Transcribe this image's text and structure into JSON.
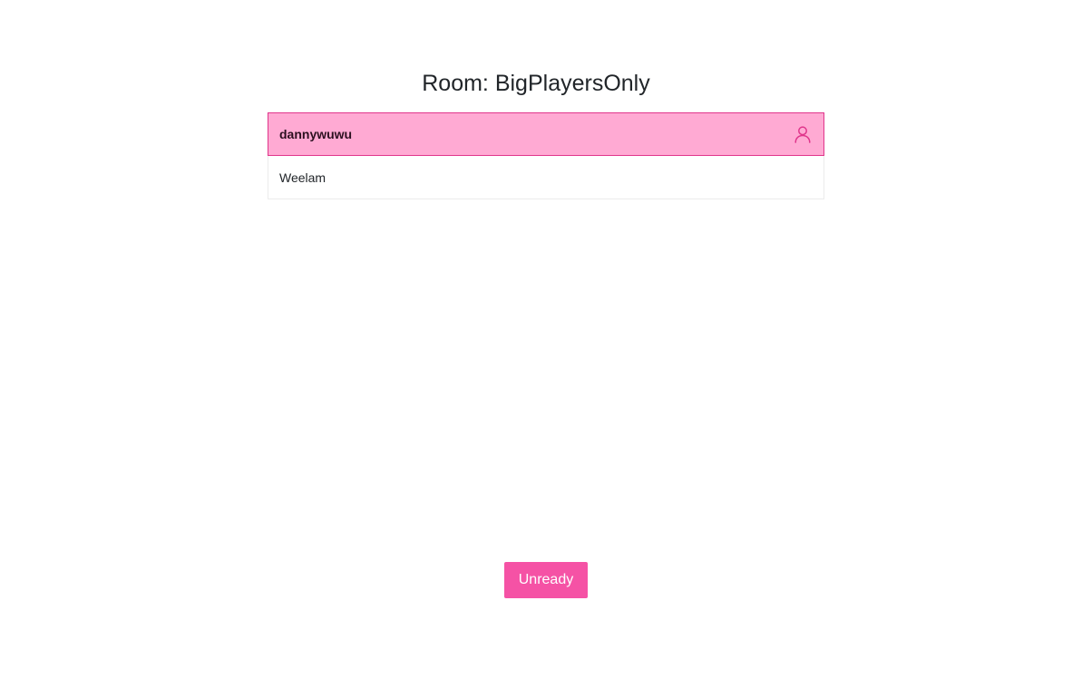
{
  "room": {
    "label": "Room: BigPlayersOnly"
  },
  "players": [
    {
      "name": "dannywuwu",
      "is_self": true,
      "icon": "user-icon"
    },
    {
      "name": "Weelam",
      "is_self": false
    }
  ],
  "actions": {
    "ready_toggle_label": "Unready"
  },
  "colors": {
    "self_row_background": "#ffaad3",
    "self_row_border": "#e0358b",
    "icon_color": "#e0358b",
    "button_background": "#f552a5",
    "button_text": "#ffffff"
  }
}
